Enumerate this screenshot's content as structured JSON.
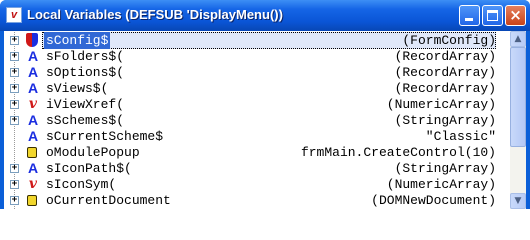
{
  "window": {
    "title": "Local Variables (DEFSUB 'DisplayMenu())",
    "app_icon": "v",
    "buttons": {
      "minimize": "minimize",
      "maximize": "maximize",
      "close": "×"
    }
  },
  "variables": [
    {
      "name": "sConfig$",
      "type": "(FormConfig)",
      "icon": "shield-icon",
      "expandable": true,
      "selected": true
    },
    {
      "name": "sFolders$(",
      "type": "(RecordArray)",
      "icon": "string-icon",
      "expandable": true
    },
    {
      "name": "sOptions$(",
      "type": "(RecordArray)",
      "icon": "string-icon",
      "expandable": true
    },
    {
      "name": "sViews$(",
      "type": "(RecordArray)",
      "icon": "string-icon",
      "expandable": true
    },
    {
      "name": "iViewXref(",
      "type": "(NumericArray)",
      "icon": "numeric-icon",
      "expandable": true
    },
    {
      "name": "sSchemes$(",
      "type": "(StringArray)",
      "icon": "string-icon",
      "expandable": true
    },
    {
      "name": "sCurrentScheme$",
      "type": "\"Classic\"",
      "icon": "string-icon",
      "expandable": false
    },
    {
      "name": "oModulePopup",
      "type": "frmMain.CreateControl(10)",
      "icon": "object-icon",
      "expandable": false
    },
    {
      "name": "sIconPath$(",
      "type": "(StringArray)",
      "icon": "string-icon",
      "expandable": true
    },
    {
      "name": "sIconSym(",
      "type": "(NumericArray)",
      "icon": "numeric-icon",
      "expandable": true
    },
    {
      "name": "oCurrentDocument",
      "type": "(DOMNewDocument)",
      "icon": "object-icon",
      "expandable": true
    }
  ],
  "icon_glyphs": {
    "string": "A",
    "numeric": "v",
    "expander": "+"
  },
  "scrollbar": {
    "up": "▲",
    "down": "▼"
  }
}
